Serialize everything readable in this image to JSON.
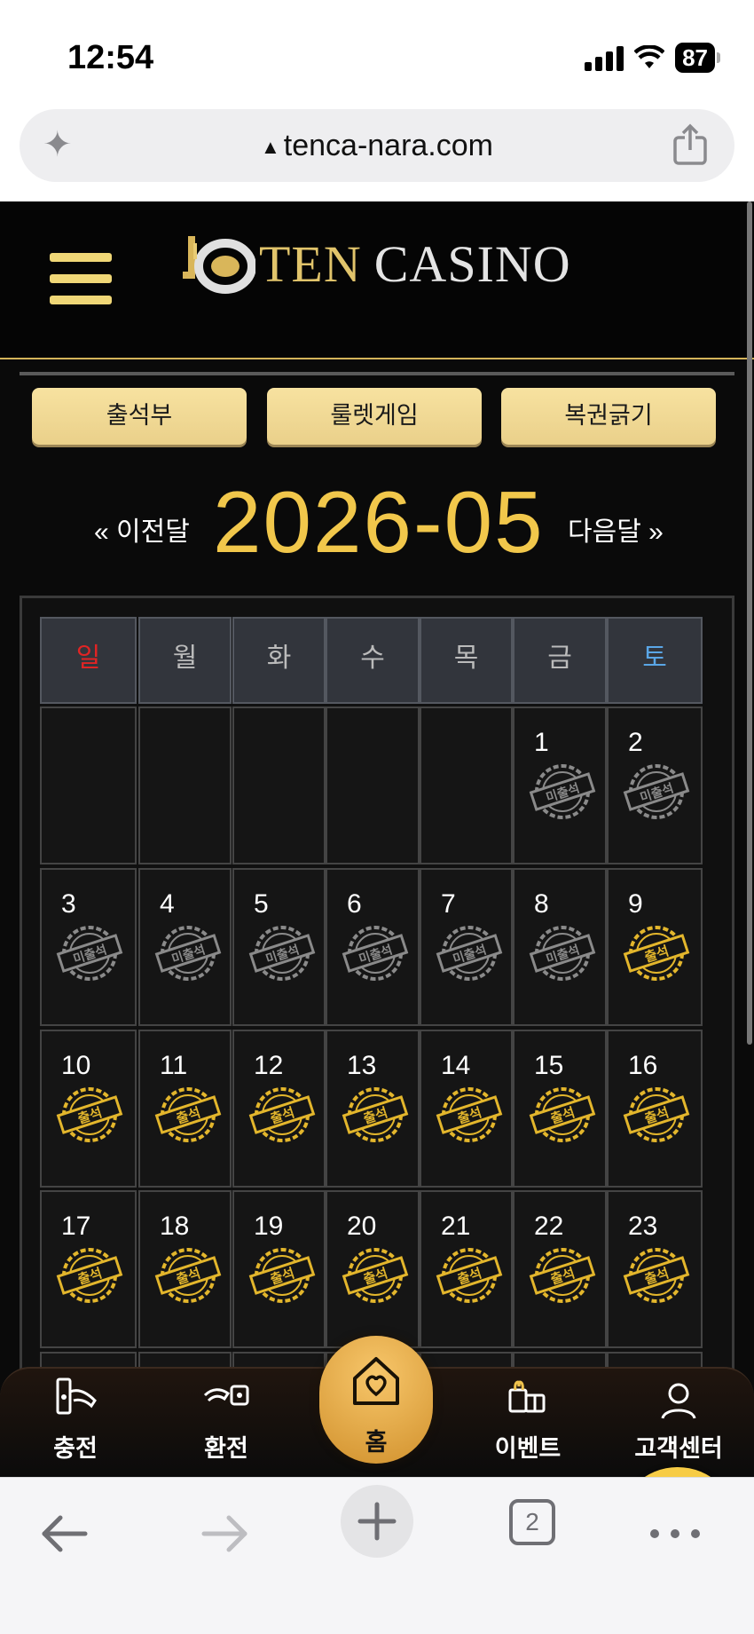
{
  "status": {
    "time": "12:54",
    "battery": "87"
  },
  "browser": {
    "url": "tenca-nara.com",
    "tabs_count": "2"
  },
  "header": {
    "logo_ten": "TEN",
    "logo_casino": "CASINO"
  },
  "tabs": [
    "출석부",
    "룰렛게임",
    "복권긁기"
  ],
  "calendar": {
    "prev": "« 이전달",
    "month": "2026-05",
    "next": "다음달 »",
    "weekdays": [
      "일",
      "월",
      "화",
      "수",
      "목",
      "금",
      "토"
    ],
    "weekday_colors": {
      "sunday": "#e02424",
      "saturday": "#5aa6e6",
      "weekday": "#bbbbbb"
    },
    "stamps": {
      "absent": "미출석",
      "present": "출석"
    },
    "days": [
      {
        "day": "1",
        "status": "absent"
      },
      {
        "day": "2",
        "status": "absent"
      },
      {
        "day": "3",
        "status": "absent"
      },
      {
        "day": "4",
        "status": "absent"
      },
      {
        "day": "5",
        "status": "absent"
      },
      {
        "day": "6",
        "status": "absent"
      },
      {
        "day": "7",
        "status": "absent"
      },
      {
        "day": "8",
        "status": "absent"
      },
      {
        "day": "9",
        "status": "present"
      },
      {
        "day": "10",
        "status": "present"
      },
      {
        "day": "11",
        "status": "present"
      },
      {
        "day": "12",
        "status": "present"
      },
      {
        "day": "13",
        "status": "present"
      },
      {
        "day": "14",
        "status": "present"
      },
      {
        "day": "15",
        "status": "present"
      },
      {
        "day": "16",
        "status": "present"
      },
      {
        "day": "17",
        "status": "present"
      },
      {
        "day": "18",
        "status": "present"
      },
      {
        "day": "19",
        "status": "present"
      },
      {
        "day": "20",
        "status": "present"
      },
      {
        "day": "21",
        "status": "present"
      },
      {
        "day": "22",
        "status": "present"
      },
      {
        "day": "23",
        "status": "present"
      }
    ]
  },
  "bottom_nav": {
    "deposit": "충전",
    "withdraw": "환전",
    "home": "홈",
    "event": "이벤트",
    "support": "고객센터"
  },
  "colors": {
    "gold": "#f1c74b",
    "button": "#f3dc96",
    "stamp_gold": "#e3b62c",
    "stamp_gray": "#8a8a8a",
    "chat": "#f7cc45"
  }
}
